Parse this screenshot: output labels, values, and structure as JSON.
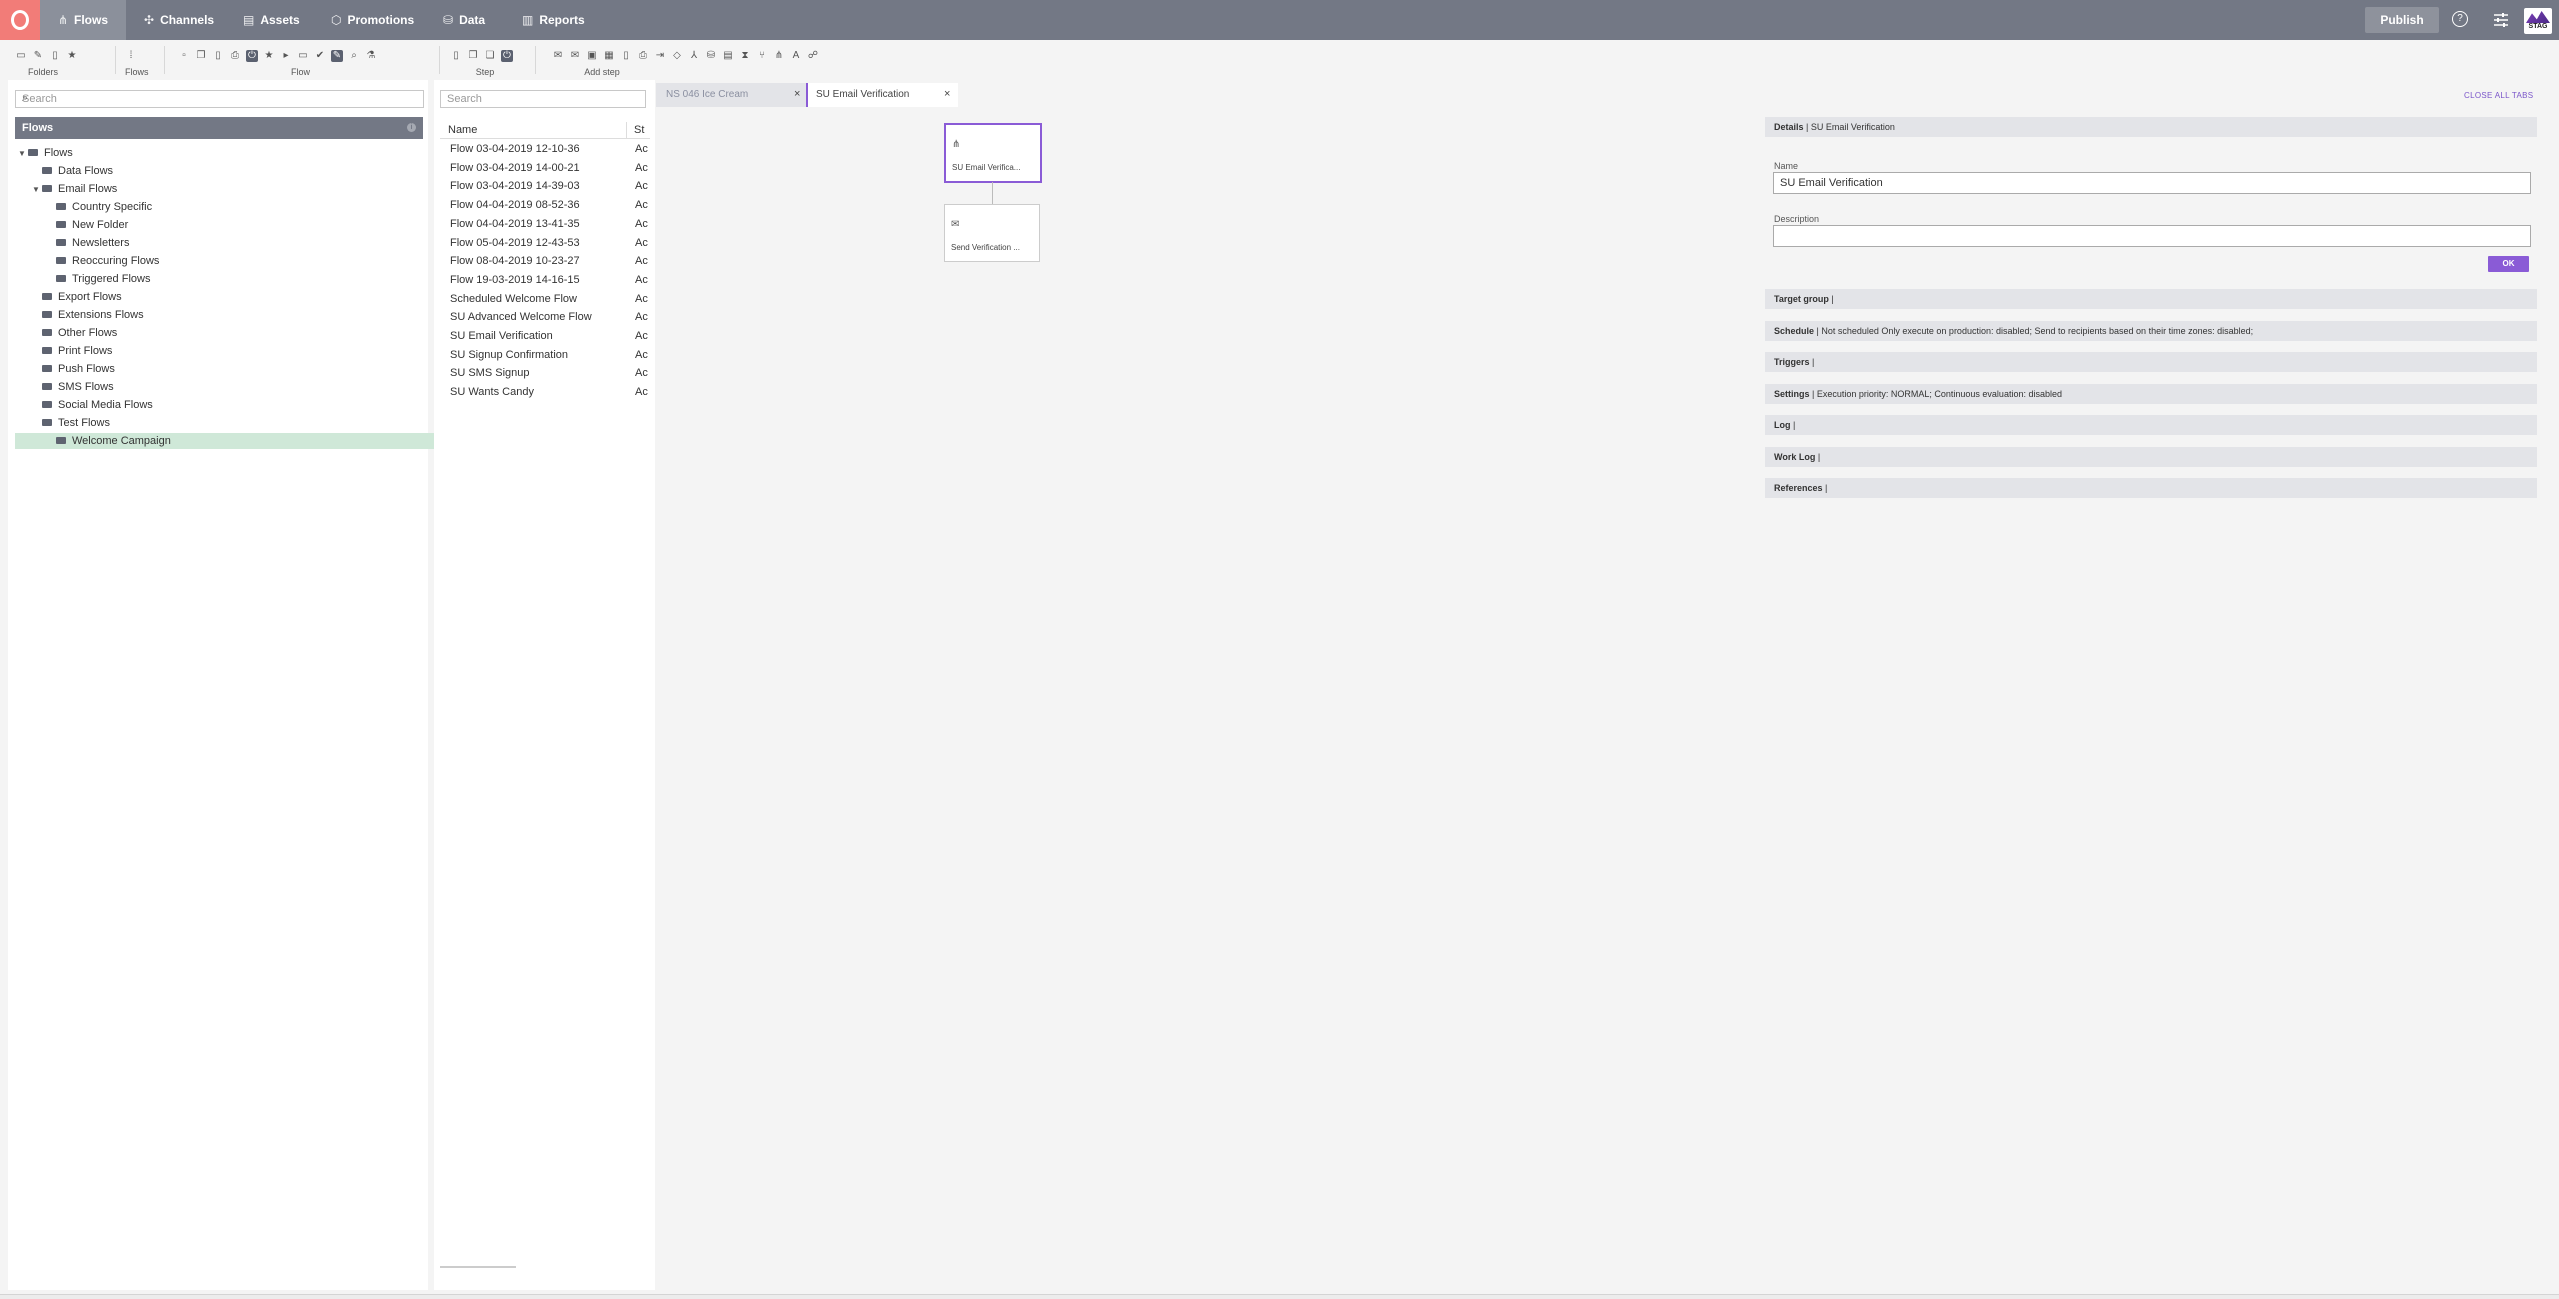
{
  "nav": {
    "items": [
      {
        "label": "Flows",
        "icon": "flows-icon"
      },
      {
        "label": "Channels",
        "icon": "channels-icon"
      },
      {
        "label": "Assets",
        "icon": "assets-icon"
      },
      {
        "label": "Promotions",
        "icon": "promotions-icon"
      },
      {
        "label": "Data",
        "icon": "data-icon"
      },
      {
        "label": "Reports",
        "icon": "reports-icon"
      }
    ],
    "active": "Flows",
    "publish_label": "Publish",
    "help_label": "?",
    "stag_label": "STAG"
  },
  "toolbar": {
    "groups": [
      {
        "label": "Folders"
      },
      {
        "label": "Flows"
      },
      {
        "label": "Flow"
      },
      {
        "label": "Step"
      },
      {
        "label": "Add step"
      }
    ]
  },
  "left": {
    "search_placeholder": "Search",
    "header": "Flows",
    "tree": [
      {
        "label": "Flows",
        "level": 0,
        "expanded": true
      },
      {
        "label": "Data Flows",
        "level": 1
      },
      {
        "label": "Email Flows",
        "level": 1,
        "expanded": true
      },
      {
        "label": "Country Specific",
        "level": 2
      },
      {
        "label": "New Folder",
        "level": 2
      },
      {
        "label": "Newsletters",
        "level": 2
      },
      {
        "label": "Reoccuring Flows",
        "level": 2
      },
      {
        "label": "Triggered Flows",
        "level": 2
      },
      {
        "label": "Export Flows",
        "level": 1
      },
      {
        "label": "Extensions Flows",
        "level": 1
      },
      {
        "label": "Other Flows",
        "level": 1
      },
      {
        "label": "Print Flows",
        "level": 1
      },
      {
        "label": "Push Flows",
        "level": 1
      },
      {
        "label": "SMS Flows",
        "level": 1
      },
      {
        "label": "Social Media Flows",
        "level": 1
      },
      {
        "label": "Test Flows",
        "level": 1
      },
      {
        "label": "Welcome Campaign",
        "level": 1,
        "selected": true
      }
    ]
  },
  "list": {
    "search_placeholder": "Search",
    "columns": [
      "Name",
      "St"
    ],
    "rows": [
      {
        "name": "Flow 03-04-2019 12-10-36",
        "status": "Ac"
      },
      {
        "name": "Flow 03-04-2019 14-00-21",
        "status": "Ac"
      },
      {
        "name": "Flow 03-04-2019 14-39-03",
        "status": "Ac"
      },
      {
        "name": "Flow 04-04-2019 08-52-36",
        "status": "Ac"
      },
      {
        "name": "Flow 04-04-2019 13-41-35",
        "status": "Ac"
      },
      {
        "name": "Flow 05-04-2019 12-43-53",
        "status": "Ac"
      },
      {
        "name": "Flow 08-04-2019 10-23-27",
        "status": "Ac"
      },
      {
        "name": "Flow 19-03-2019 14-16-15",
        "status": "Ac"
      },
      {
        "name": "Scheduled Welcome Flow",
        "status": "Ac"
      },
      {
        "name": "SU Advanced Welcome Flow",
        "status": "Ac"
      },
      {
        "name": "SU Email Verification",
        "status": "Ac"
      },
      {
        "name": "SU Signup Confirmation",
        "status": "Ac"
      },
      {
        "name": "SU SMS Signup",
        "status": "Ac"
      },
      {
        "name": "SU Wants Candy",
        "status": "Ac"
      }
    ]
  },
  "tabs": [
    {
      "label": "NS 046 Ice Cream",
      "active": false
    },
    {
      "label": "SU Email Verification",
      "active": true
    }
  ],
  "close_all_label": "CLOSE ALL TABS",
  "canvas": {
    "nodes": [
      {
        "label": "SU Email Verifica...",
        "icon": "flow-start-icon"
      },
      {
        "label": "Send Verification ...",
        "icon": "email-icon"
      }
    ]
  },
  "details": {
    "title_bold": "Details",
    "title_rest": " | SU Email Verification",
    "name_label": "Name",
    "name_value": "SU Email Verification",
    "desc_label": "Description",
    "desc_value": "",
    "ok_label": "OK",
    "sections": [
      {
        "bold": "Target group",
        "rest": " |"
      },
      {
        "bold": "Schedule",
        "rest": " | Not scheduled Only execute on production: disabled; Send to recipients based on their time zones: disabled;"
      },
      {
        "bold": "Triggers",
        "rest": " |"
      },
      {
        "bold": "Settings",
        "rest": " | Execution priority: NORMAL; Continuous evaluation: disabled"
      },
      {
        "bold": "Log",
        "rest": " |"
      },
      {
        "bold": "Work Log",
        "rest": " |"
      },
      {
        "bold": "References",
        "rest": " |"
      }
    ]
  },
  "colors": {
    "nav_bg": "#737885",
    "logo": "#f27c78",
    "accent": "#8a5bd6",
    "selected_row": "#cfe8d8"
  }
}
